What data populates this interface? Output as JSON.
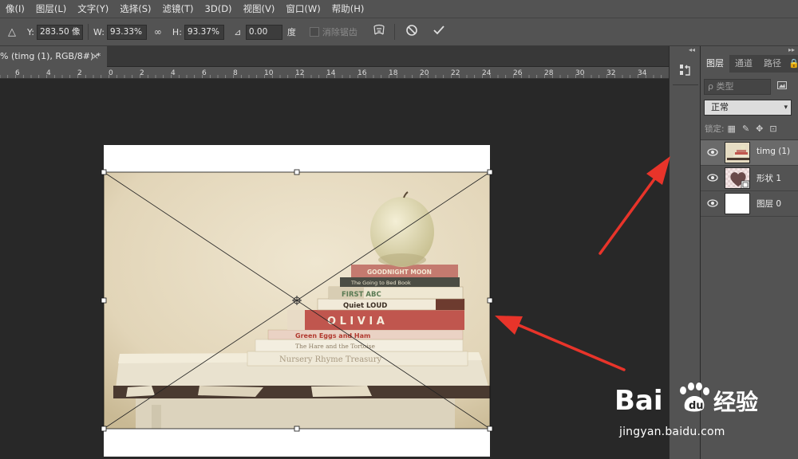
{
  "menubar": {
    "items": [
      "像(I)",
      "图层(L)",
      "文字(Y)",
      "选择(S)",
      "滤镜(T)",
      "3D(D)",
      "视图(V)",
      "窗口(W)",
      "帮助(H)"
    ]
  },
  "options": {
    "y_label": "Y:",
    "y_value": "283.50 像",
    "w_label": "W:",
    "w_value": "93.33%",
    "h_label": "H:",
    "h_value": "93.37%",
    "angle_value": "0.00",
    "angle_unit": "度",
    "antialias_label": "消除锯齿"
  },
  "document": {
    "tab_title": "% (timg (1), RGB/8#) *",
    "close_glyph": "×"
  },
  "ruler": {
    "labels": [
      "6",
      "4",
      "2",
      "0",
      "2",
      "4",
      "6",
      "8",
      "10",
      "12",
      "14",
      "16",
      "18",
      "20",
      "22",
      "24",
      "26",
      "28",
      "30",
      "32",
      "34"
    ]
  },
  "photo": {
    "books": [
      "GOODNIGHT MOON",
      "The Going to Bed Book",
      "FIRST  ABC",
      "Quiet LOUD",
      "O L I V I A",
      "Green Eggs and Ham",
      "The Hare and the Tortoise",
      "Nursery Rhyme Treasury"
    ]
  },
  "panels": {
    "tabs": [
      "图层",
      "通道",
      "路径",
      "🔒"
    ],
    "filter_placeholder": "ρ 类型",
    "blend_mode": "正常",
    "lock_label": "锁定:",
    "layers": [
      {
        "name": "timg (1)",
        "selected": true
      },
      {
        "name": "形状 1",
        "selected": false
      },
      {
        "name": "图层 0",
        "selected": false
      }
    ]
  },
  "watermark": {
    "brand": "Bai",
    "brand_suffix": "经验",
    "url": "jingyan.baidu.com"
  },
  "colors": {
    "accent_red": "#e8342a",
    "panel_bg": "#535353",
    "workspace_bg": "#282828"
  }
}
